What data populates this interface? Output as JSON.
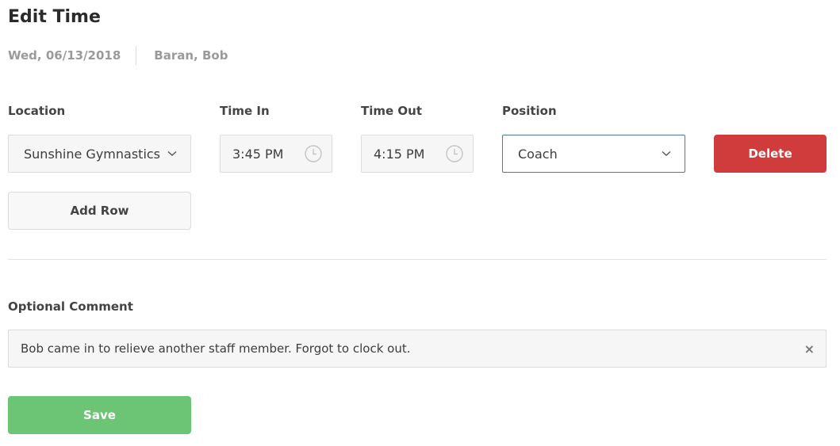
{
  "header": {
    "title": "Edit Time",
    "date": "Wed, 06/13/2018",
    "employee": "Baran, Bob"
  },
  "row": {
    "location_label": "Location",
    "location_value": "Sunshine Gymnastics",
    "time_in_label": "Time In",
    "time_in_value": "3:45 PM",
    "time_out_label": "Time Out",
    "time_out_value": "4:15 PM",
    "position_label": "Position",
    "position_value": "Coach",
    "delete_label": "Delete"
  },
  "add_row_label": "Add Row",
  "comment": {
    "label": "Optional Comment",
    "value": "Bob came in to relieve another staff member. Forgot to clock out.",
    "clear_glyph": "×"
  },
  "save_label": "Save",
  "icons": {
    "location_dropdown": "chevron-down-icon",
    "time_in": "clock-icon",
    "time_out": "clock-icon",
    "position_dropdown": "chevron-down-icon",
    "comment_clear": "close-icon"
  },
  "colors": {
    "delete": "#d03b3b",
    "save": "#6cc475",
    "focus_border": "#4b7aa8"
  }
}
